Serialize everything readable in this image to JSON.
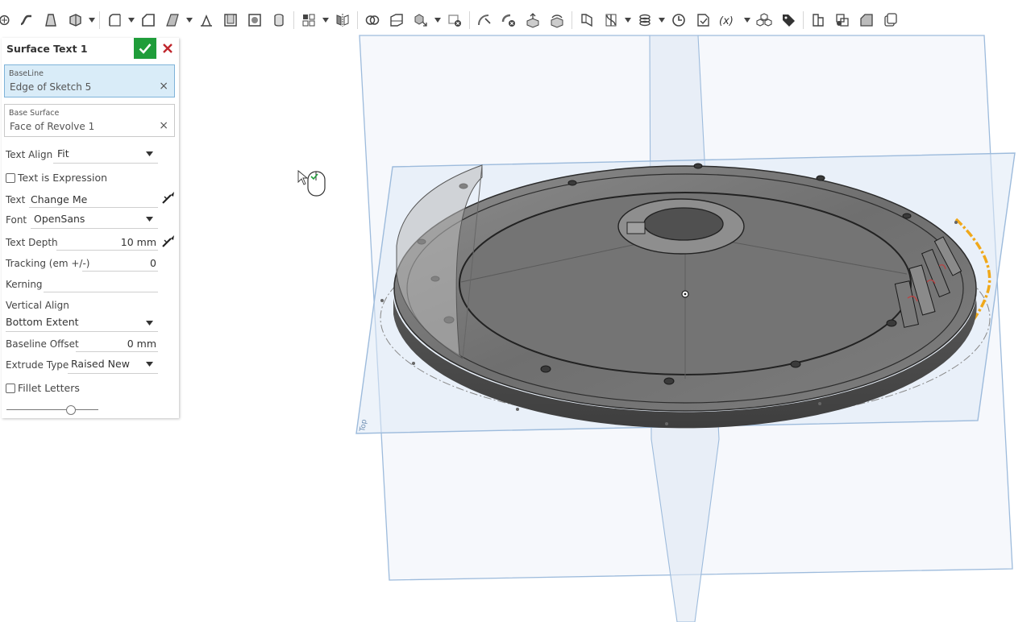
{
  "toolbar": {
    "icons": [
      "sketch-icon",
      "sweep-icon",
      "loft-icon",
      "thicken-icon",
      "fillet-icon",
      "chamfer-icon",
      "draft-icon",
      "rib-icon",
      "shell-icon",
      "hole-icon",
      "linear-pattern-icon",
      "mirror-icon",
      "boolean-icon",
      "split-icon",
      "transform-icon",
      "delete-part-icon",
      "modify-fillet-icon",
      "delete-face-icon",
      "move-face-icon",
      "replace-face-icon",
      "plane-icon",
      "helix-icon",
      "mate-connector-icon",
      "measure-icon",
      "variable-icon",
      "expression-icon",
      "composite-icon",
      "tag-icon",
      "sheet-metal-icon",
      "flange-icon",
      "surface-icon",
      "offset-icon"
    ]
  },
  "dialog": {
    "title": "Surface Text 1",
    "baseline": {
      "label": "BaseLine",
      "value": "Edge of Sketch 5"
    },
    "base_surface": {
      "label": "Base Surface",
      "value": "Face of Revolve 1"
    },
    "text_align": {
      "label": "Text Align",
      "value": "Fit"
    },
    "text_is_expression": {
      "label": "Text is Expression",
      "checked": false
    },
    "text": {
      "label": "Text",
      "value": "Change Me"
    },
    "font": {
      "label": "Font",
      "value": "OpenSans"
    },
    "text_depth": {
      "label": "Text Depth",
      "value": "10 mm"
    },
    "tracking": {
      "label": "Tracking (em +/-)",
      "value": "0"
    },
    "kerning": {
      "label": "Kerning",
      "value": ""
    },
    "vertical_align": {
      "label": "Vertical Align",
      "value": "Bottom Extent"
    },
    "baseline_offset": {
      "label": "Baseline Offset",
      "value": "0 mm"
    },
    "extrude_type": {
      "label": "Extrude Type",
      "value": "Raised New"
    },
    "fillet_letters": {
      "label": "Fillet Letters",
      "checked": false
    },
    "slider": {
      "value": 0.7
    }
  },
  "viewport": {
    "plane_label": "Top",
    "colors": {
      "plane": "#9dbbdc",
      "plane_fill": "#e6eef8",
      "highlight": "#f0a81a",
      "part": "#7a7a7a"
    }
  }
}
